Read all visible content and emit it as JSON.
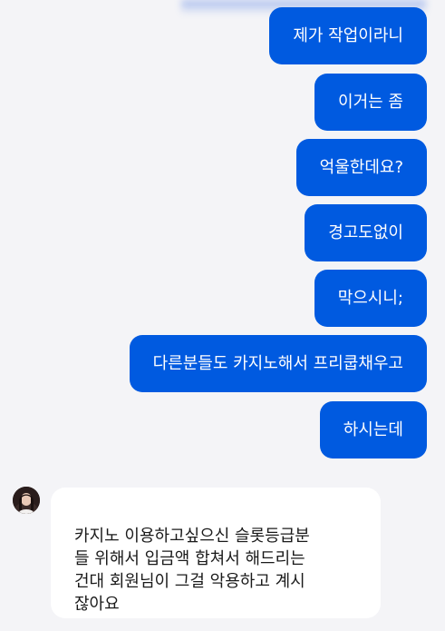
{
  "chat": {
    "outgoing": [
      {
        "text": "제가 작업이라니"
      },
      {
        "text": "이거는 좀"
      },
      {
        "text": "억울한데요?"
      },
      {
        "text": "경고도없이"
      },
      {
        "text": "막으시니;"
      },
      {
        "text": "다른분들도 카지노해서 프리쿱채우고"
      },
      {
        "text": "하시는데"
      }
    ],
    "incoming": {
      "text": "카지노 이용하고싶으신 슬롯등급분\n들 위해서 입금액 합쳐서 해드리는\n건대 회원님이 그걸 악용하고 계시\n잖아요"
    }
  },
  "colors": {
    "outgoing_bubble": "#005ae0",
    "incoming_bubble": "#ffffff",
    "background": "#f4f4f7"
  }
}
